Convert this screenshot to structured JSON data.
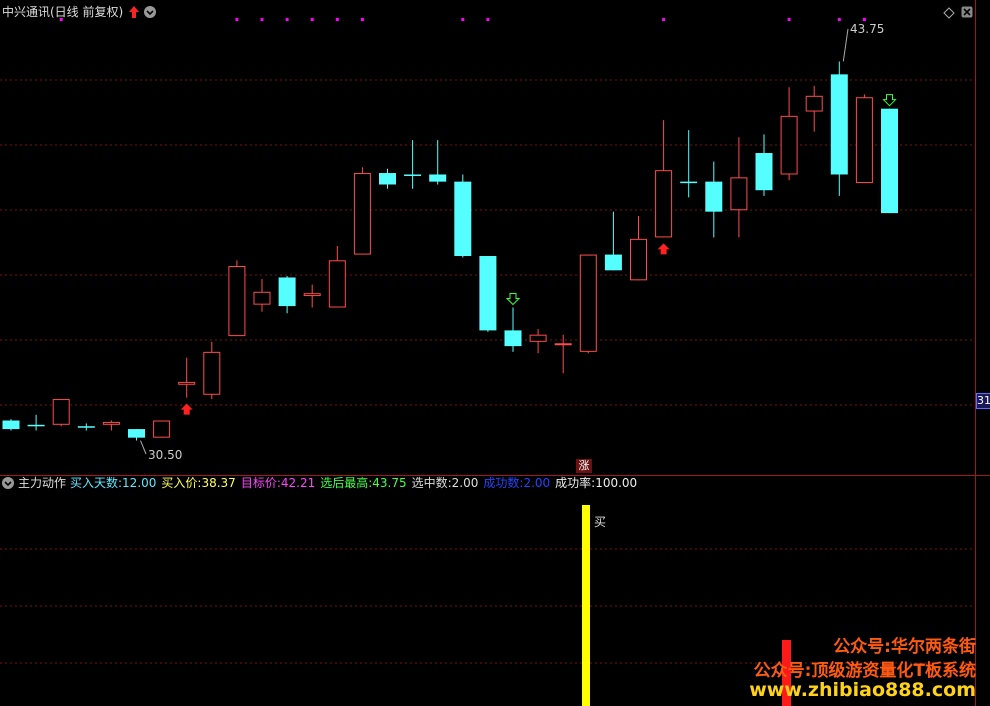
{
  "header": {
    "title": "中兴通讯(日线 前复权)"
  },
  "indicator": {
    "name": "主力动作",
    "items": [
      {
        "label": "买入天数:",
        "value": "12.00",
        "color": "#5ee8ff"
      },
      {
        "label": "买入价:",
        "value": "38.37",
        "color": "#ffff55"
      },
      {
        "label": "目标价:",
        "value": "42.21",
        "color": "#ff44ff"
      },
      {
        "label": "选后最高:",
        "value": "43.75",
        "color": "#44ff44"
      },
      {
        "label": "选中数:",
        "value": "2.00",
        "color": "#dddddd"
      },
      {
        "label": "成功数:",
        "value": "2.00",
        "color": "#2244ff"
      },
      {
        "label": "成功率:",
        "value": "100.00",
        "color": "#eeeeee"
      }
    ],
    "buy_label": "买",
    "zhang_label": "涨"
  },
  "axis": {
    "right_tag": "31"
  },
  "watermark": {
    "line1": "公众号:华尔两条街",
    "line2": "公众号:顶级游资量化T板系统",
    "line3": "www.zhibiao888.com"
  },
  "colors": {
    "up": "#ff4b4b",
    "down": "#55ffff",
    "grid": "#7a1010",
    "signal_bar": "#ffff00",
    "dots": "#ff00ff"
  },
  "chart_data": {
    "type": "candlestick",
    "ylim": [
      29.4,
      45.2
    ],
    "annotations": {
      "high_label": "43.75",
      "low_label": "30.50"
    },
    "candles": [
      {
        "o": 31.2,
        "h": 31.25,
        "l": 30.85,
        "c": 30.9
      },
      {
        "o": 31.05,
        "h": 31.4,
        "l": 30.85,
        "c": 31.0
      },
      {
        "o": 31.05,
        "h": 31.25,
        "l": 31.0,
        "c": 31.95
      },
      {
        "o": 31.0,
        "h": 31.1,
        "l": 30.85,
        "c": 30.95
      },
      {
        "o": 31.05,
        "h": 31.2,
        "l": 30.85,
        "c": 31.15
      },
      {
        "o": 30.9,
        "h": 30.9,
        "l": 30.5,
        "c": 30.6
      },
      {
        "o": 30.6,
        "h": 31.2,
        "l": 30.6,
        "c": 31.2
      },
      {
        "o": 32.45,
        "h": 33.4,
        "l": 32.0,
        "c": 32.55
      },
      {
        "o": 32.1,
        "h": 33.95,
        "l": 31.95,
        "c": 33.6
      },
      {
        "o": 34.15,
        "h": 36.8,
        "l": 34.15,
        "c": 36.6
      },
      {
        "o": 35.25,
        "h": 36.15,
        "l": 35.0,
        "c": 35.7
      },
      {
        "o": 36.2,
        "h": 36.25,
        "l": 34.95,
        "c": 35.2
      },
      {
        "o": 35.55,
        "h": 35.95,
        "l": 35.15,
        "c": 35.65
      },
      {
        "o": 35.15,
        "h": 37.3,
        "l": 35.15,
        "c": 36.8
      },
      {
        "o": 37.0,
        "h": 40.05,
        "l": 37.0,
        "c": 39.85
      },
      {
        "o": 39.85,
        "h": 40.0,
        "l": 39.3,
        "c": 39.45
      },
      {
        "o": 39.8,
        "h": 41.0,
        "l": 39.3,
        "c": 39.75
      },
      {
        "o": 39.8,
        "h": 41.0,
        "l": 39.45,
        "c": 39.55
      },
      {
        "o": 39.55,
        "h": 39.8,
        "l": 36.9,
        "c": 36.95
      },
      {
        "o": 36.95,
        "h": 36.95,
        "l": 34.3,
        "c": 34.35
      },
      {
        "o": 34.35,
        "h": 35.15,
        "l": 33.6,
        "c": 33.8
      },
      {
        "o": 33.95,
        "h": 34.4,
        "l": 33.55,
        "c": 34.2
      },
      {
        "o": 33.9,
        "h": 34.2,
        "l": 32.85,
        "c": 33.9
      },
      {
        "o": 33.6,
        "h": 37.0,
        "l": 33.55,
        "c": 37.0
      },
      {
        "o": 37.0,
        "h": 38.5,
        "l": 36.45,
        "c": 36.45
      },
      {
        "o": 36.1,
        "h": 38.35,
        "l": 36.1,
        "c": 37.55
      },
      {
        "o": 37.6,
        "h": 41.7,
        "l": 37.6,
        "c": 39.95
      },
      {
        "o": 39.55,
        "h": 41.35,
        "l": 39.0,
        "c": 39.5
      },
      {
        "o": 39.55,
        "h": 40.25,
        "l": 37.6,
        "c": 38.5
      },
      {
        "o": 38.55,
        "h": 41.1,
        "l": 37.6,
        "c": 39.7
      },
      {
        "o": 40.55,
        "h": 41.2,
        "l": 39.05,
        "c": 39.25
      },
      {
        "o": 39.8,
        "h": 42.85,
        "l": 39.6,
        "c": 41.85
      },
      {
        "o": 42.0,
        "h": 42.9,
        "l": 41.3,
        "c": 42.55
      },
      {
        "o": 43.3,
        "h": 43.75,
        "l": 39.05,
        "c": 39.8
      },
      {
        "o": 39.5,
        "h": 42.6,
        "l": 39.5,
        "c": 42.5
      },
      {
        "o": 42.1,
        "h": 42.1,
        "l": 38.45,
        "c": 38.45
      }
    ],
    "markers": [
      {
        "type": "buy-arrow",
        "candle": 7
      },
      {
        "type": "buy-arrow",
        "candle": 26
      },
      {
        "type": "sell-arrow",
        "candle": 20
      },
      {
        "type": "sell-arrow",
        "candle": 35
      }
    ],
    "top_dots": [
      2,
      9,
      10,
      11,
      12,
      13,
      14,
      18,
      19,
      26,
      31,
      33,
      34
    ]
  }
}
